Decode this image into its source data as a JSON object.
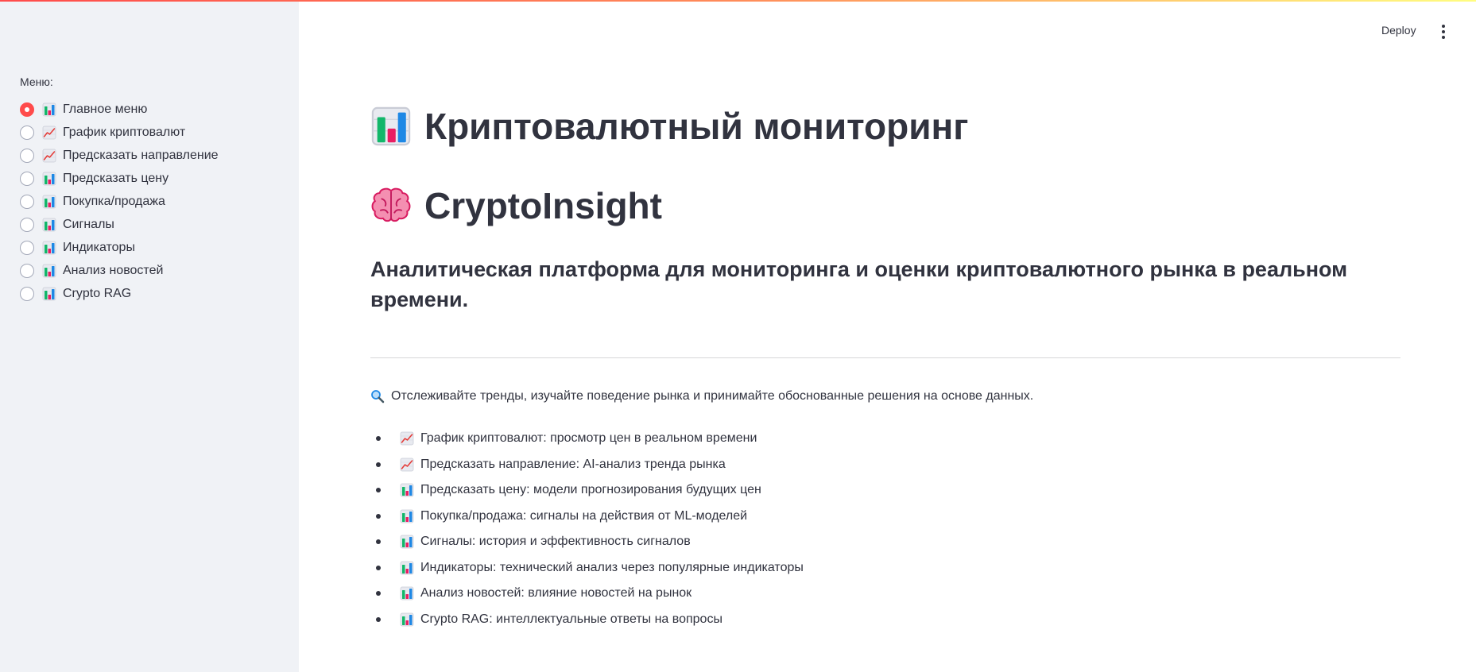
{
  "header": {
    "deploy_label": "Deploy"
  },
  "sidebar": {
    "menu_label": "Меню:",
    "selected_index": 0,
    "items": [
      {
        "label": "Главное меню",
        "icon": "bar-chart-icon"
      },
      {
        "label": "График криптовалют",
        "icon": "chart-increasing-icon"
      },
      {
        "label": "Предсказать направление",
        "icon": "chart-increasing-icon"
      },
      {
        "label": "Предсказать цену",
        "icon": "bar-chart-icon"
      },
      {
        "label": "Покупка/продажа",
        "icon": "bar-chart-icon"
      },
      {
        "label": "Сигналы",
        "icon": "bar-chart-icon"
      },
      {
        "label": "Индикаторы",
        "icon": "bar-chart-icon"
      },
      {
        "label": "Анализ новостей",
        "icon": "bar-chart-icon"
      },
      {
        "label": "Crypto RAG",
        "icon": "bar-chart-icon"
      }
    ]
  },
  "main": {
    "title": "Криптовалютный мониторинг",
    "title_icon": "bar-chart-icon",
    "app_name": "CryptoInsight",
    "app_name_icon": "brain-icon",
    "subtitle": "Аналитическая платформа для мониторинга и оценки криптовалютного рынка в реальном времени.",
    "intro": "Отслеживайте тренды, изучайте поведение рынка и принимайте обоснованные решения на основе данных.",
    "intro_icon": "magnifier-icon",
    "features": [
      {
        "text": "График криптовалют: просмотр цен в реальном времени",
        "icon": "chart-increasing-icon"
      },
      {
        "text": "Предсказать направление: AI-анализ тренда рынка",
        "icon": "chart-increasing-icon"
      },
      {
        "text": "Предсказать цену: модели прогнозирования будущих цен",
        "icon": "bar-chart-icon"
      },
      {
        "text": "Покупка/продажа: сигналы на действия от ML-моделей",
        "icon": "bar-chart-icon"
      },
      {
        "text": "Сигналы: история и эффективность сигналов",
        "icon": "bar-chart-icon"
      },
      {
        "text": "Индикаторы: технический анализ через популярные индикаторы",
        "icon": "bar-chart-icon"
      },
      {
        "text": "Анализ новостей: влияние новостей на рынок",
        "icon": "bar-chart-icon"
      },
      {
        "text": "Crypto RAG: интеллектуальные ответы на вопросы",
        "icon": "bar-chart-icon"
      }
    ]
  },
  "colors": {
    "accent": "#ff4b4b",
    "sidebar_bg": "#f0f2f6",
    "text": "#31333f"
  }
}
